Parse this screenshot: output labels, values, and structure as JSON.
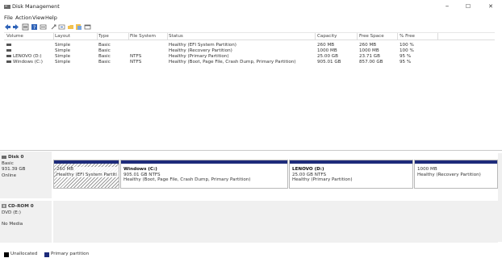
{
  "window": {
    "title": "Disk Management",
    "controls": {
      "minimize": "–",
      "maximize": "☐",
      "close": "✕"
    }
  },
  "menu": [
    "File",
    "Action",
    "View",
    "Help"
  ],
  "toolbar_icons": [
    "back-icon",
    "forward-icon",
    "list-view-icon",
    "help-icon",
    "properties-icon",
    "refresh-icon",
    "rescan-icon",
    "folder-icon",
    "help-topic-icon",
    "console-icon"
  ],
  "volumes": {
    "columns": [
      "Volume",
      "Layout",
      "Type",
      "File System",
      "Status",
      "Capacity",
      "Free Space",
      "% Free"
    ],
    "rows": [
      {
        "volume": "",
        "layout": "Simple",
        "type": "Basic",
        "fs": "",
        "status": "Healthy (EFI System Partition)",
        "capacity": "260 MB",
        "free": "260 MB",
        "pct": "100 %"
      },
      {
        "volume": "",
        "layout": "Simple",
        "type": "Basic",
        "fs": "",
        "status": "Healthy (Recovery Partition)",
        "capacity": "1000 MB",
        "free": "1000 MB",
        "pct": "100 %"
      },
      {
        "volume": "LENOVO (D:)",
        "layout": "Simple",
        "type": "Basic",
        "fs": "NTFS",
        "status": "Healthy (Primary Partition)",
        "capacity": "25.00 GB",
        "free": "23.71 GB",
        "pct": "95 %"
      },
      {
        "volume": "Windows (C:)",
        "layout": "Simple",
        "type": "Basic",
        "fs": "NTFS",
        "status": "Healthy (Boot, Page File, Crash Dump, Primary Partition)",
        "capacity": "905.01 GB",
        "free": "857.00 GB",
        "pct": "95 %"
      }
    ]
  },
  "disks": [
    {
      "name": "Disk 0",
      "type": "Basic",
      "size": "931.39 GB",
      "state": "Online",
      "partitions": [
        {
          "title": "",
          "size": "260 MB",
          "status": "Healthy (EFI System Partiti",
          "hatched": true
        },
        {
          "title": "Windows (C:)",
          "size": "905.01 GB NTFS",
          "status": "Healthy (Boot, Page File, Crash Dump, Primary Partition)",
          "hatched": false
        },
        {
          "title": "LENOVO (D:)",
          "size": "25.00 GB NTFS",
          "status": "Healthy (Primary Partition)",
          "hatched": false
        },
        {
          "title": "",
          "size": "1000 MB",
          "status": "Healthy (Recovery Partition)",
          "hatched": false
        }
      ]
    },
    {
      "name": "CD-ROM 0",
      "type": "DVD (E:)",
      "size": "",
      "state": "No Media"
    }
  ],
  "legend": [
    {
      "label": "Unallocated",
      "color": "#000000"
    },
    {
      "label": "Primary partition",
      "color": "#1d2b7a"
    }
  ],
  "colors": {
    "partition_bar": "#1d2b7a",
    "unallocated": "#000000"
  }
}
